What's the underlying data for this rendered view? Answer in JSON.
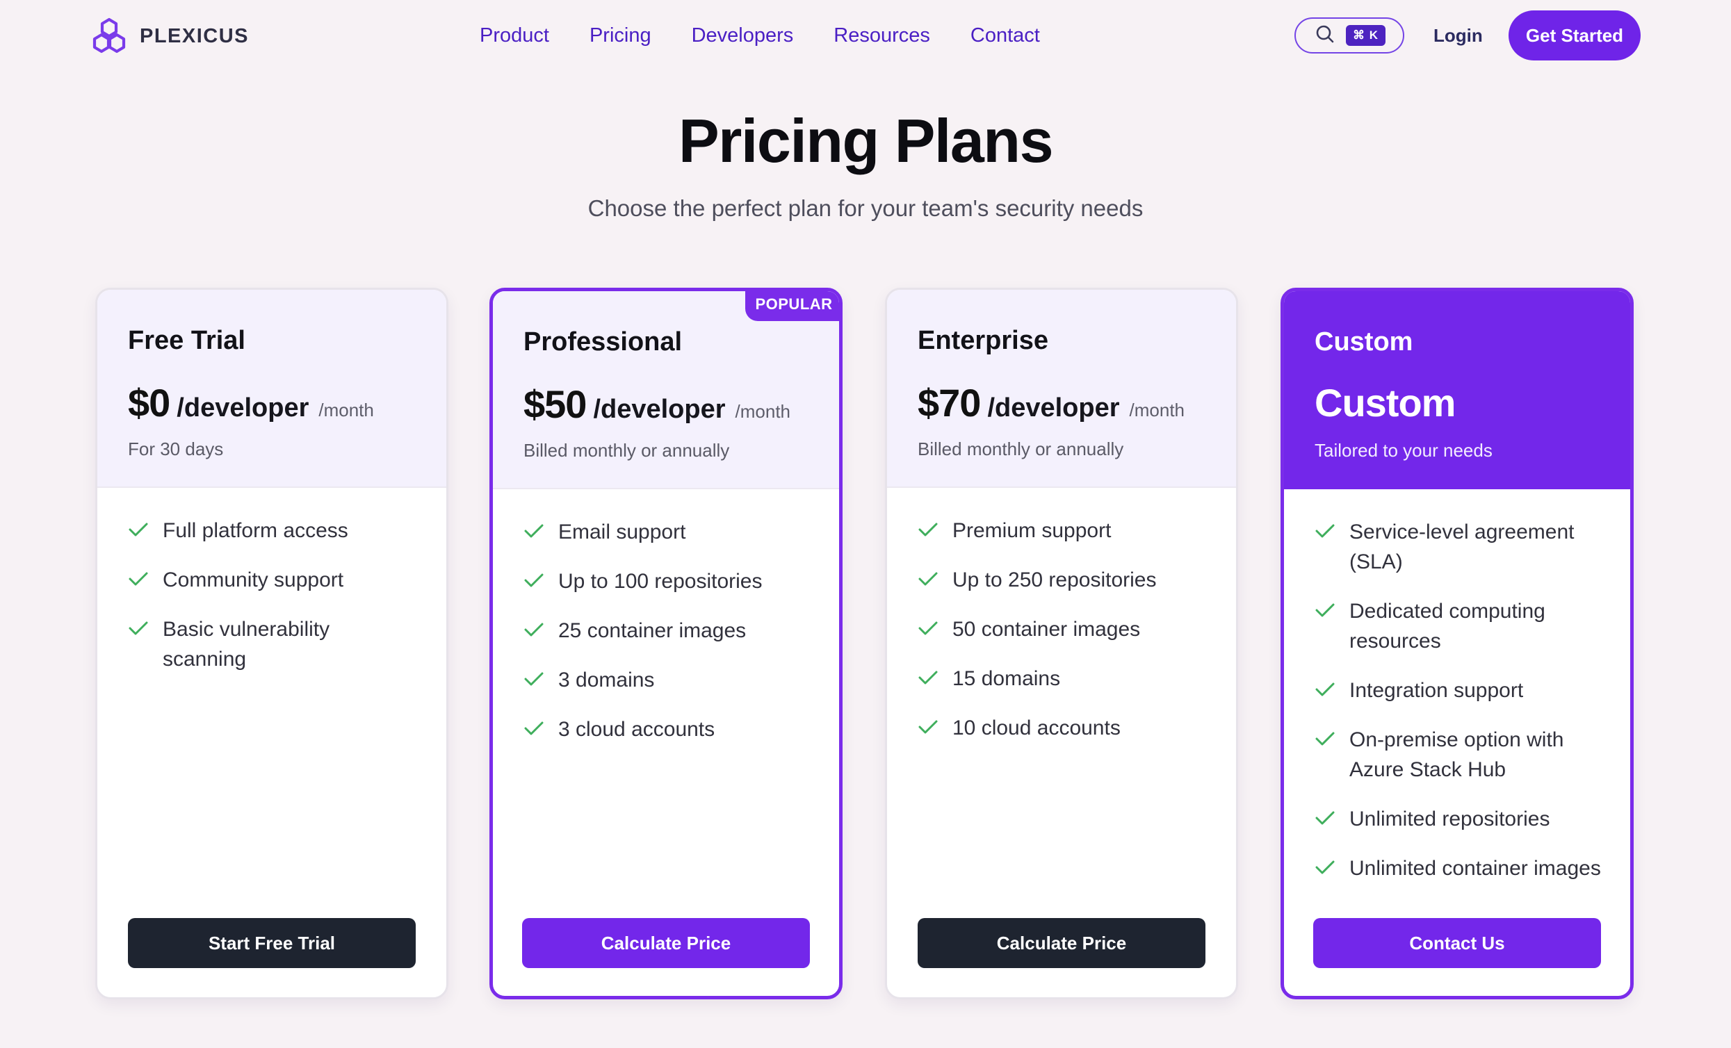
{
  "brand": {
    "name": "PLEXICUS"
  },
  "nav": {
    "items": [
      "Product",
      "Pricing",
      "Developers",
      "Resources",
      "Contact"
    ]
  },
  "header": {
    "search_shortcut": "⌘ K",
    "login_label": "Login",
    "get_started_label": "Get Started"
  },
  "hero": {
    "title": "Pricing Plans",
    "subtitle": "Choose the perfect plan for your team's security needs"
  },
  "plans": [
    {
      "name": "Free Trial",
      "price": "$0",
      "unit": "/developer",
      "period": "/month",
      "note": "For 30 days",
      "features": [
        "Full platform access",
        "Community support",
        "Basic vulnerability scanning"
      ],
      "cta": "Start Free Trial"
    },
    {
      "name": "Professional",
      "badge": "POPULAR",
      "price": "$50",
      "unit": "/developer",
      "period": "/month",
      "note": "Billed monthly or annually",
      "features": [
        "Email support",
        "Up to 100 repositories",
        "25 container images",
        "3 domains",
        "3 cloud accounts"
      ],
      "cta": "Calculate Price"
    },
    {
      "name": "Enterprise",
      "price": "$70",
      "unit": "/developer",
      "period": "/month",
      "note": "Billed monthly or annually",
      "features": [
        "Premium support",
        "Up to 250 repositories",
        "50 container images",
        "15 domains",
        "10 cloud accounts"
      ],
      "cta": "Calculate Price"
    },
    {
      "name": "Custom",
      "price": "Custom",
      "note": "Tailored to your needs",
      "features": [
        "Service-level agreement (SLA)",
        "Dedicated computing resources",
        "Integration support",
        "On-premise option with Azure Stack Hub",
        "Unlimited repositories",
        "Unlimited container images"
      ],
      "cta": "Contact Us"
    }
  ],
  "colors": {
    "brand_purple": "#7327ea",
    "nav_text": "#4a1fc4",
    "dark_button": "#1e2430",
    "check_green": "#3fae5c",
    "page_bg": "#f7f2f5"
  },
  "icons": [
    "plexicus-logo-icon",
    "search-icon",
    "check-icon"
  ]
}
